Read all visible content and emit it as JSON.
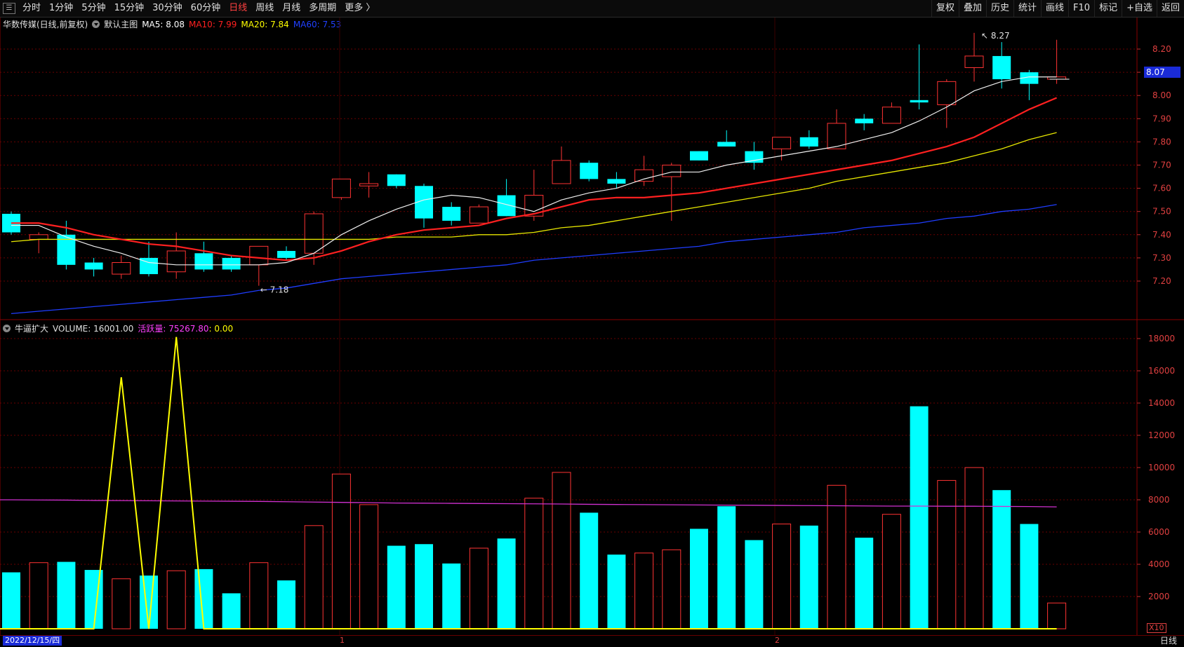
{
  "toolbar": {
    "left": [
      "分时",
      "1分钟",
      "5分钟",
      "15分钟",
      "30分钟",
      "60分钟",
      "日线",
      "周线",
      "月线",
      "多周期",
      "更多 〉"
    ],
    "active": "日线",
    "right": [
      "复权",
      "叠加",
      "历史",
      "统计",
      "画线",
      "F10",
      "标记",
      "+自选",
      "返回"
    ]
  },
  "main_header": {
    "name": "华数传媒(日线,前复权)",
    "template": "默认主图",
    "ma5": "MA5: 8.08",
    "ma10": "MA10: 7.99",
    "ma20": "MA20: 7.84",
    "ma60": "MA60: 7.53",
    "colors": {
      "ma5": "#ffffff",
      "ma10": "#ff2020",
      "ma20": "#ffff00",
      "ma60": "#2040ff"
    }
  },
  "vol_header": {
    "name": "牛逼扩大",
    "volume": "VOLUME: 16001.00",
    "active": "活跃量: 75267.80",
    "extra": ": 0.00"
  },
  "current_price": "8.07",
  "annotations": {
    "high": "8.27",
    "low": "7.18"
  },
  "status": {
    "date": "2022/12/15/四",
    "period": "日线",
    "month1": "1",
    "month2": "2",
    "scale": "X10"
  },
  "colors": {
    "up": "#ff3333",
    "down": "#00ffff",
    "bg": "#000000",
    "grid": "#6a0000"
  },
  "chart_data": [
    {
      "type": "candlestick",
      "title": "华数传媒(日线,前复权)",
      "ylim": [
        7.05,
        8.3
      ],
      "y_ticks": [
        8.2,
        8.1,
        8.0,
        7.9,
        7.8,
        7.7,
        7.6,
        7.5,
        7.4,
        7.3,
        7.2
      ],
      "candles": [
        {
          "o": 7.49,
          "h": 7.5,
          "l": 7.4,
          "c": 7.41
        },
        {
          "o": 7.38,
          "h": 7.41,
          "l": 7.32,
          "c": 7.4
        },
        {
          "o": 7.4,
          "h": 7.46,
          "l": 7.25,
          "c": 7.27
        },
        {
          "o": 7.28,
          "h": 7.3,
          "l": 7.22,
          "c": 7.25
        },
        {
          "o": 7.23,
          "h": 7.31,
          "l": 7.21,
          "c": 7.28
        },
        {
          "o": 7.3,
          "h": 7.37,
          "l": 7.22,
          "c": 7.23
        },
        {
          "o": 7.24,
          "h": 7.41,
          "l": 7.21,
          "c": 7.33
        },
        {
          "o": 7.32,
          "h": 7.37,
          "l": 7.24,
          "c": 7.25
        },
        {
          "o": 7.3,
          "h": 7.31,
          "l": 7.24,
          "c": 7.25
        },
        {
          "o": 7.27,
          "h": 7.35,
          "l": 7.18,
          "c": 7.35
        },
        {
          "o": 7.33,
          "h": 7.35,
          "l": 7.29,
          "c": 7.3
        },
        {
          "o": 7.32,
          "h": 7.5,
          "l": 7.27,
          "c": 7.49
        },
        {
          "o": 7.56,
          "h": 7.64,
          "l": 7.55,
          "c": 7.64
        },
        {
          "o": 7.61,
          "h": 7.67,
          "l": 7.56,
          "c": 7.62
        },
        {
          "o": 7.66,
          "h": 7.66,
          "l": 7.6,
          "c": 7.61
        },
        {
          "o": 7.61,
          "h": 7.62,
          "l": 7.43,
          "c": 7.47
        },
        {
          "o": 7.52,
          "h": 7.54,
          "l": 7.44,
          "c": 7.46
        },
        {
          "o": 7.45,
          "h": 7.53,
          "l": 7.45,
          "c": 7.52
        },
        {
          "o": 7.57,
          "h": 7.64,
          "l": 7.48,
          "c": 7.48
        },
        {
          "o": 7.48,
          "h": 7.68,
          "l": 7.46,
          "c": 7.57
        },
        {
          "o": 7.62,
          "h": 7.78,
          "l": 7.62,
          "c": 7.72
        },
        {
          "o": 7.71,
          "h": 7.72,
          "l": 7.63,
          "c": 7.64
        },
        {
          "o": 7.64,
          "h": 7.67,
          "l": 7.6,
          "c": 7.62
        },
        {
          "o": 7.63,
          "h": 7.74,
          "l": 7.61,
          "c": 7.68
        },
        {
          "o": 7.65,
          "h": 7.71,
          "l": 7.46,
          "c": 7.7
        },
        {
          "o": 7.76,
          "h": 7.76,
          "l": 7.72,
          "c": 7.72
        },
        {
          "o": 7.8,
          "h": 7.85,
          "l": 7.78,
          "c": 7.78
        },
        {
          "o": 7.76,
          "h": 7.8,
          "l": 7.68,
          "c": 7.71
        },
        {
          "o": 7.77,
          "h": 7.82,
          "l": 7.72,
          "c": 7.82
        },
        {
          "o": 7.82,
          "h": 7.85,
          "l": 7.77,
          "c": 7.78
        },
        {
          "o": 7.77,
          "h": 7.94,
          "l": 7.77,
          "c": 7.88
        },
        {
          "o": 7.9,
          "h": 7.92,
          "l": 7.85,
          "c": 7.88
        },
        {
          "o": 7.88,
          "h": 7.97,
          "l": 7.88,
          "c": 7.95
        },
        {
          "o": 7.98,
          "h": 8.22,
          "l": 7.94,
          "c": 7.97
        },
        {
          "o": 7.96,
          "h": 8.07,
          "l": 7.86,
          "c": 8.06
        },
        {
          "o": 8.12,
          "h": 8.27,
          "l": 8.06,
          "c": 8.17
        },
        {
          "o": 8.17,
          "h": 8.23,
          "l": 8.03,
          "c": 8.07
        },
        {
          "o": 8.1,
          "h": 8.11,
          "l": 7.98,
          "c": 8.05
        },
        {
          "o": 8.07,
          "h": 8.24,
          "l": 8.05,
          "c": 8.08
        }
      ],
      "ma5": [
        7.44,
        7.44,
        7.39,
        7.35,
        7.32,
        7.28,
        7.27,
        7.27,
        7.27,
        7.27,
        7.28,
        7.32,
        7.4,
        7.46,
        7.51,
        7.55,
        7.57,
        7.56,
        7.53,
        7.5,
        7.55,
        7.58,
        7.6,
        7.64,
        7.67,
        7.67,
        7.7,
        7.72,
        7.74,
        7.76,
        7.78,
        7.81,
        7.84,
        7.89,
        7.95,
        8.02,
        8.06,
        8.08,
        8.08
      ],
      "ma10": [
        7.45,
        7.45,
        7.43,
        7.4,
        7.38,
        7.36,
        7.35,
        7.33,
        7.31,
        7.3,
        7.29,
        7.3,
        7.33,
        7.37,
        7.4,
        7.42,
        7.43,
        7.44,
        7.47,
        7.49,
        7.52,
        7.55,
        7.56,
        7.56,
        7.57,
        7.58,
        7.6,
        7.62,
        7.64,
        7.66,
        7.68,
        7.7,
        7.72,
        7.75,
        7.78,
        7.82,
        7.88,
        7.94,
        7.99
      ],
      "ma20": [
        7.37,
        7.38,
        7.38,
        7.38,
        7.38,
        7.38,
        7.38,
        7.38,
        7.38,
        7.38,
        7.38,
        7.38,
        7.38,
        7.38,
        7.39,
        7.39,
        7.39,
        7.4,
        7.4,
        7.41,
        7.43,
        7.44,
        7.46,
        7.48,
        7.5,
        7.52,
        7.54,
        7.56,
        7.58,
        7.6,
        7.63,
        7.65,
        7.67,
        7.69,
        7.71,
        7.74,
        7.77,
        7.81,
        7.84
      ],
      "ma60": [
        7.06,
        7.07,
        7.08,
        7.09,
        7.1,
        7.11,
        7.12,
        7.13,
        7.14,
        7.16,
        7.17,
        7.19,
        7.21,
        7.22,
        7.23,
        7.24,
        7.25,
        7.26,
        7.27,
        7.29,
        7.3,
        7.31,
        7.32,
        7.33,
        7.34,
        7.35,
        7.37,
        7.38,
        7.39,
        7.4,
        7.41,
        7.43,
        7.44,
        7.45,
        7.47,
        7.48,
        7.5,
        7.51,
        7.53
      ]
    },
    {
      "type": "bar",
      "title": "牛逼扩大",
      "ylim": [
        0,
        19000
      ],
      "y_ticks": [
        18000,
        16000,
        14000,
        12000,
        10000,
        8000,
        6000,
        4000,
        2000
      ],
      "volume": [
        3500,
        4100,
        4150,
        3650,
        3100,
        3300,
        3600,
        3700,
        2200,
        4100,
        3000,
        6400,
        9600,
        7700,
        5150,
        5250,
        4050,
        5000,
        5600,
        8100,
        9700,
        7200,
        4600,
        4700,
        4900,
        6200,
        7600,
        5500,
        6500,
        6400,
        8900,
        5650,
        7100,
        13800,
        9200,
        10000,
        8600,
        6500,
        1600
      ],
      "active_line": [
        8000,
        7990,
        7980,
        7960,
        7950,
        7940,
        7930,
        7920,
        7910,
        7900,
        7880,
        7860,
        7840,
        7820,
        7800,
        7790,
        7780,
        7770,
        7760,
        7750,
        7740,
        7720,
        7710,
        7700,
        7690,
        7680,
        7670,
        7660,
        7650,
        7640,
        7630,
        7620,
        7610,
        7610,
        7600,
        7600,
        7590,
        7580,
        7560
      ],
      "signal_line": [
        0,
        0,
        0,
        0,
        15600,
        0,
        18100,
        0,
        0,
        0,
        0,
        0,
        0,
        0,
        0,
        0,
        0,
        0,
        0,
        0,
        0,
        0,
        0,
        0,
        0,
        0,
        0,
        0,
        0,
        0,
        0,
        0,
        0,
        0,
        0,
        0,
        0,
        0,
        0
      ]
    }
  ]
}
